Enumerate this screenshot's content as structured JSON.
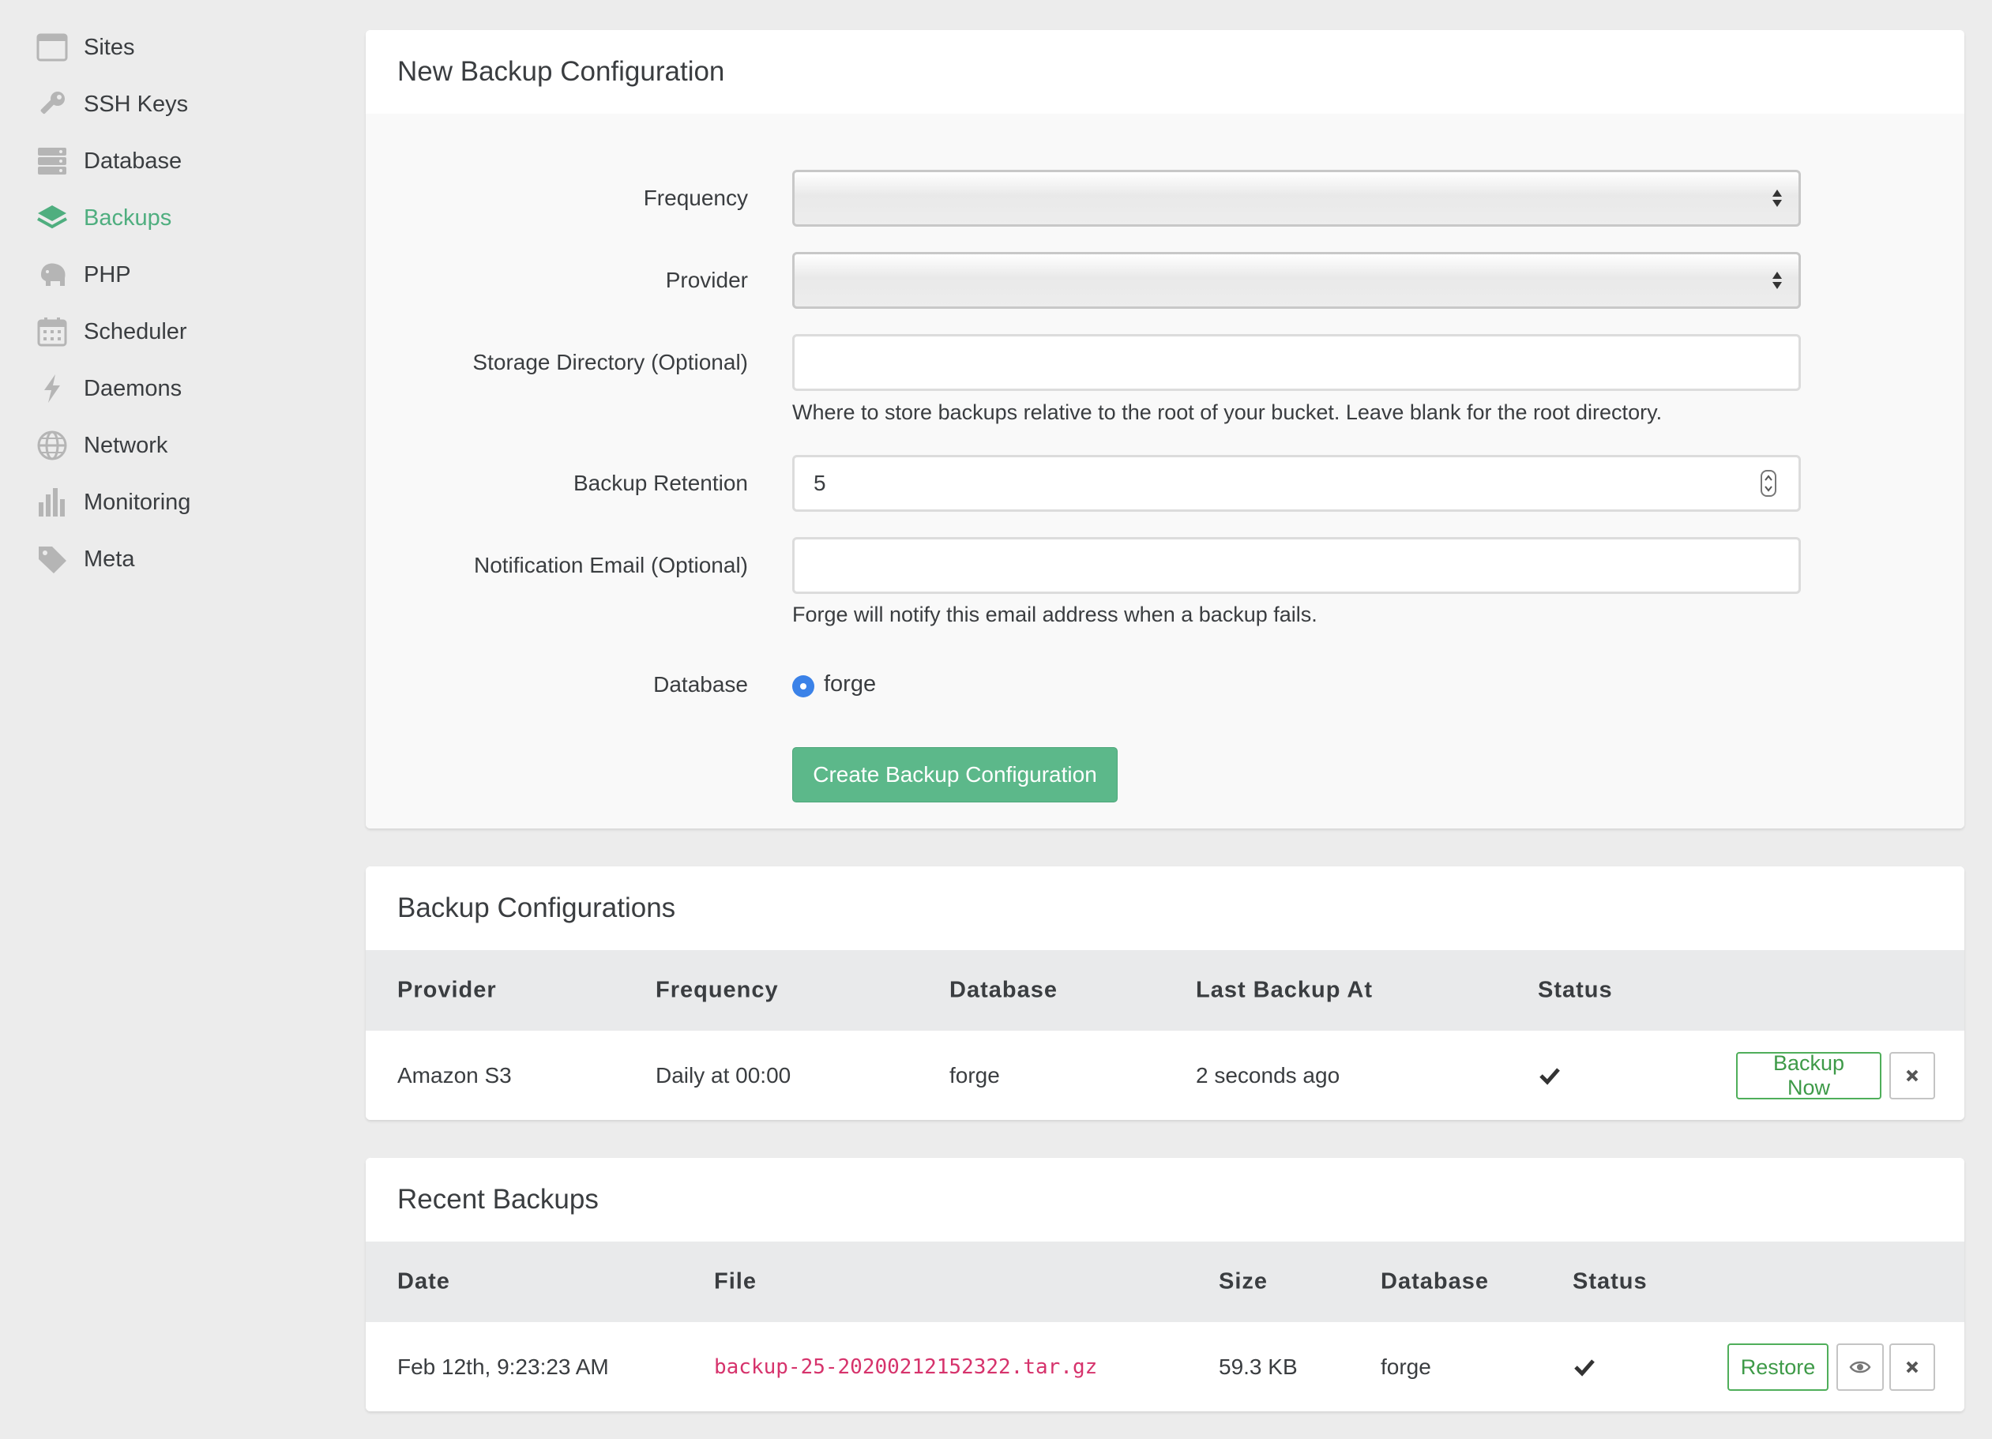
{
  "sidebar": {
    "items": [
      {
        "label": "Sites",
        "icon": "window-icon"
      },
      {
        "label": "SSH Keys",
        "icon": "key-icon"
      },
      {
        "label": "Database",
        "icon": "database-icon"
      },
      {
        "label": "Backups",
        "icon": "layers-icon",
        "active": true
      },
      {
        "label": "PHP",
        "icon": "elephant-icon"
      },
      {
        "label": "Scheduler",
        "icon": "calendar-icon"
      },
      {
        "label": "Daemons",
        "icon": "bolt-icon"
      },
      {
        "label": "Network",
        "icon": "globe-icon"
      },
      {
        "label": "Monitoring",
        "icon": "bar-chart-icon"
      },
      {
        "label": "Meta",
        "icon": "tag-icon"
      }
    ]
  },
  "new_backup": {
    "title": "New Backup Configuration",
    "frequency_label": "Frequency",
    "frequency_value": "",
    "provider_label": "Provider",
    "provider_value": "",
    "storage_label": "Storage Directory (Optional)",
    "storage_value": "",
    "storage_help": "Where to store backups relative to the root of your bucket. Leave blank for the root directory.",
    "retention_label": "Backup Retention",
    "retention_value": "5",
    "email_label": "Notification Email (Optional)",
    "email_value": "",
    "email_help": "Forge will notify this email address when a backup fails.",
    "database_label": "Database",
    "database_option": "forge",
    "submit_label": "Create Backup Configuration"
  },
  "configurations": {
    "title": "Backup Configurations",
    "columns": [
      "Provider",
      "Frequency",
      "Database",
      "Last Backup At",
      "Status"
    ],
    "rows": [
      {
        "provider": "Amazon S3",
        "frequency": "Daily at 00:00",
        "database": "forge",
        "last_backup": "2 seconds ago",
        "status": "success",
        "action_label": "Backup Now"
      }
    ]
  },
  "recent": {
    "title": "Recent Backups",
    "columns": [
      "Date",
      "File",
      "Size",
      "Database",
      "Status"
    ],
    "rows": [
      {
        "date": "Feb 12th, 9:23:23 AM",
        "file": "backup-25-20200212152322.tar.gz",
        "size": "59.3 KB",
        "database": "forge",
        "status": "success",
        "action_label": "Restore"
      }
    ]
  },
  "colors": {
    "accent": "#4fae7f",
    "primary_button": "#5cb88a",
    "file_link": "#d6336c",
    "radio": "#3b82e8"
  }
}
